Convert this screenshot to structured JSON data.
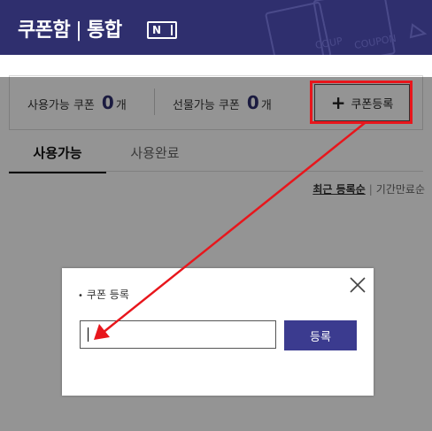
{
  "header": {
    "title": "쿠폰함",
    "separator": "|",
    "subtitle": "통합",
    "badge_letter": "N",
    "deco_text": "COUPON",
    "bg_color": "#2f2f6e"
  },
  "counts": {
    "usable_label": "사용가능 쿠폰",
    "usable_value": "0",
    "usable_unit": "개",
    "giftable_label": "선물가능 쿠폰",
    "giftable_value": "0",
    "giftable_unit": "개"
  },
  "register_button": {
    "icon": "plus-icon",
    "plus": "+",
    "label": "쿠폰등록"
  },
  "tabs": [
    {
      "label": "사용가능",
      "active": true
    },
    {
      "label": "사용완료",
      "active": false
    }
  ],
  "sort": {
    "active": "최근 등록순",
    "separator": "|",
    "other": "기간만료순"
  },
  "modal": {
    "bullet": "•",
    "title": "쿠폰 등록",
    "input_value": "",
    "submit_label": "등록",
    "close_icon": "close-icon"
  },
  "annotation": {
    "highlight_color": "#e8161c"
  }
}
